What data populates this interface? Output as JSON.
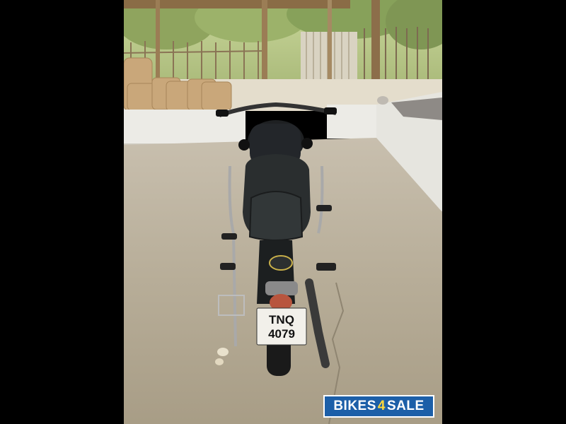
{
  "image": {
    "description_free": true,
    "license_plate": {
      "line1": "TNQ",
      "line2": "4079"
    },
    "tank_badge_text": "",
    "colors": {
      "plate_bg": "#f2f0ea",
      "bike_body": "#1b1d1f",
      "floor": "#b8ad98",
      "watermark_blue": "#1c5fa8"
    }
  },
  "watermark": {
    "prefix": "BIKES",
    "middle": "4",
    "suffix": "SALE"
  }
}
